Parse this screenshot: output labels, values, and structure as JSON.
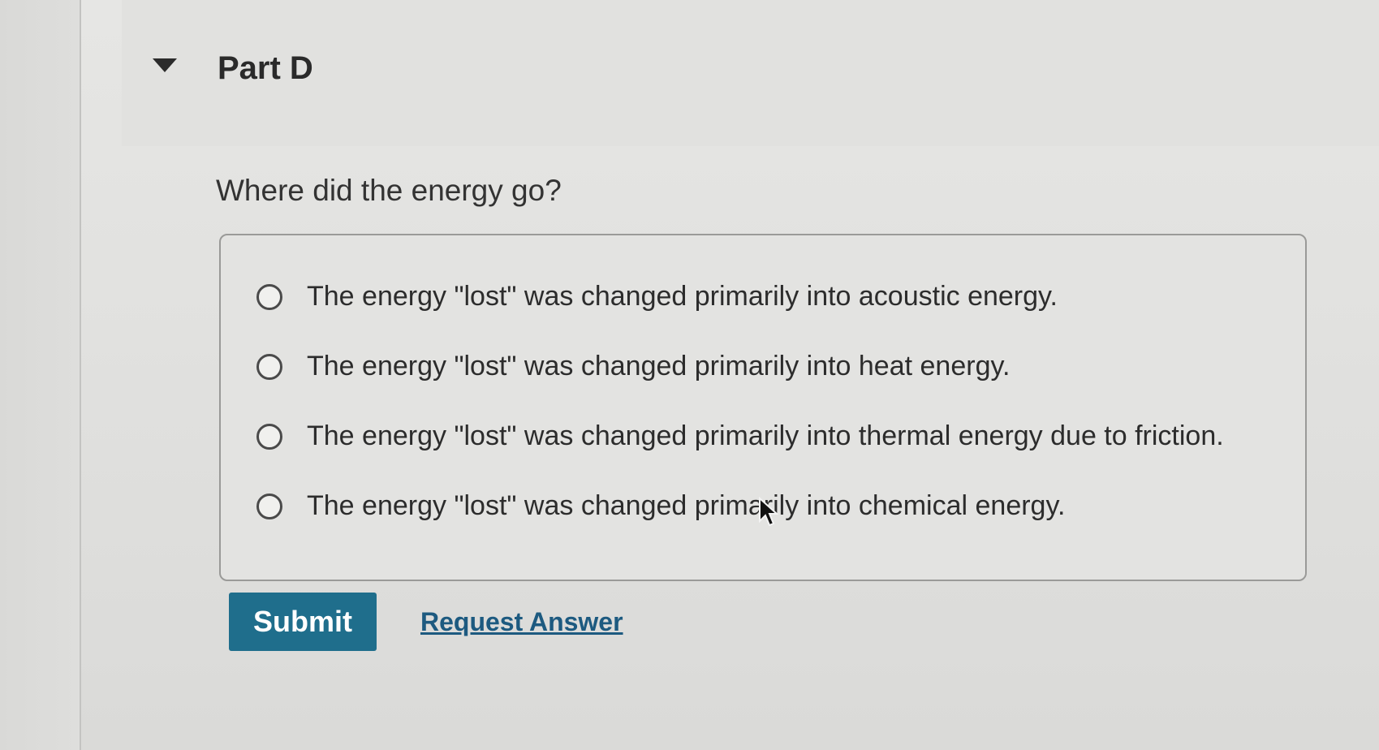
{
  "part": {
    "title": "Part D"
  },
  "question": {
    "text": "Where did the energy go?"
  },
  "options": [
    {
      "label": "The energy \"lost\" was changed primarily into acoustic energy."
    },
    {
      "label": "The energy \"lost\" was changed primarily into heat energy."
    },
    {
      "label": "The energy \"lost\" was changed primarily into thermal energy due to friction."
    },
    {
      "label": "The energy \"lost\" was changed primarily into chemical energy."
    }
  ],
  "actions": {
    "submit_label": "Submit",
    "request_answer_label": "Request Answer"
  },
  "colors": {
    "submit_bg": "#1f6e8c",
    "link": "#1d5a80"
  }
}
